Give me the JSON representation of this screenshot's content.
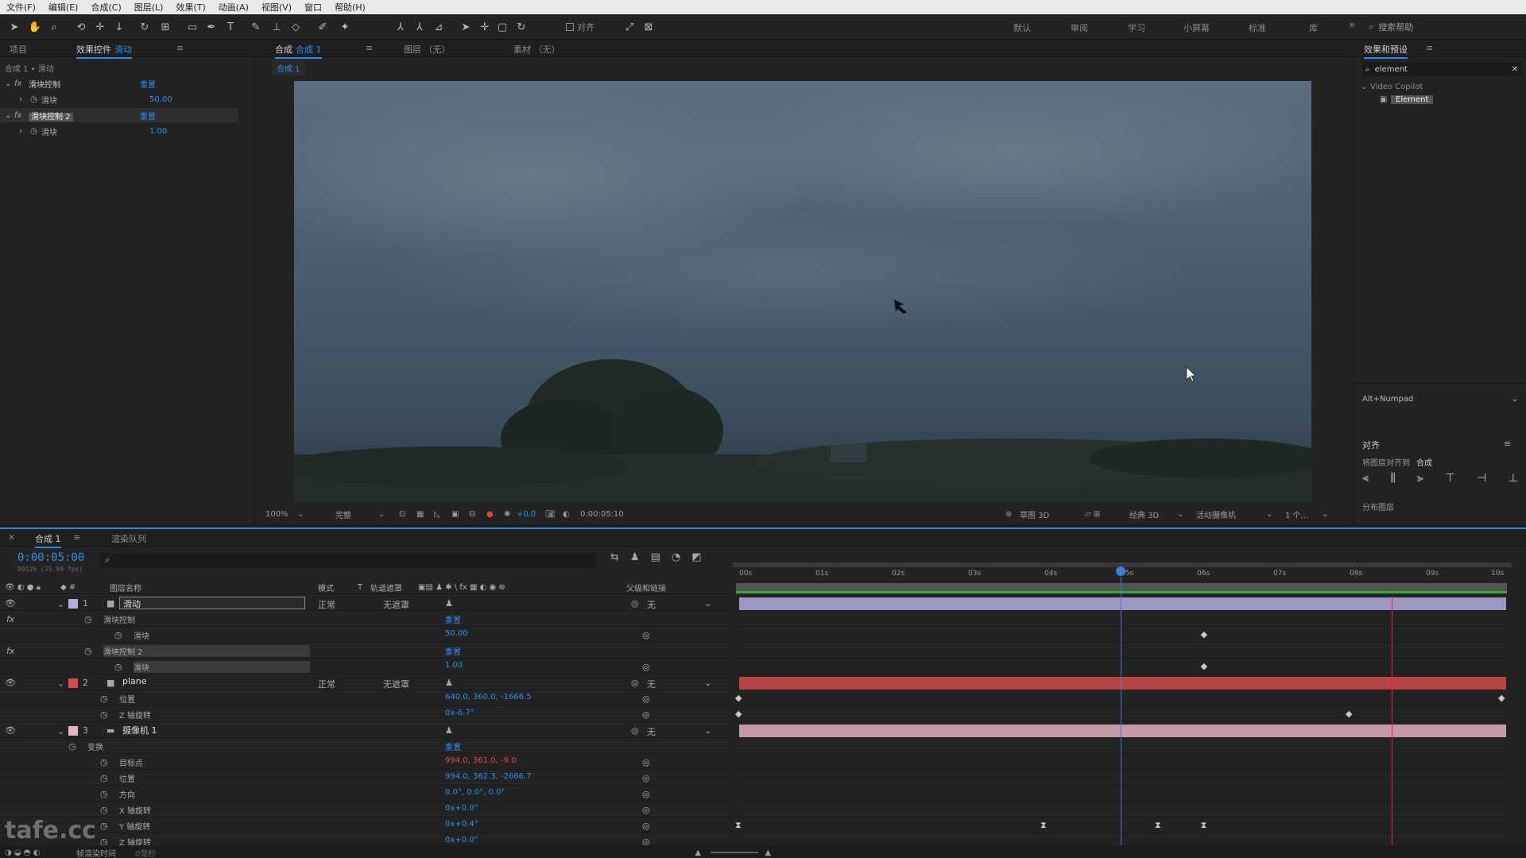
{
  "menu": [
    "文件(F)",
    "编辑(E)",
    "合成(C)",
    "图层(L)",
    "效果(T)",
    "动画(A)",
    "视图(V)",
    "窗口",
    "帮助(H)"
  ],
  "toolbar": {
    "snap_label": "对齐",
    "workspaces": [
      "默认",
      "审阅",
      "学习",
      "小屏幕",
      "标准",
      "库"
    ],
    "search_placeholder": "搜索帮助"
  },
  "left_panel": {
    "tab_project": "项目",
    "tab_effects_prefix": "效果控件",
    "tab_effects_layer": "滑动",
    "breadcrumb": "合成 1 • 滑动",
    "effects": [
      {
        "fx": "fx",
        "name": "滑块控制",
        "reset": "重置",
        "prop": "滑块",
        "value": "50.00"
      },
      {
        "fx": "fx",
        "name": "滑块控制 2",
        "reset": "重置",
        "prop": "滑块",
        "value": "1.00"
      }
    ]
  },
  "comp_panel": {
    "tab_comp": "合成",
    "tab_comp_name": "合成 1",
    "tab_layer": "图层 （无）",
    "tab_footage": "素材 （无）",
    "comp_label": "合成 1",
    "zoom": "100%",
    "quality": "完整",
    "exposure": "+0.0",
    "timecode": "0:00:05:10",
    "renderer_draft": "草图 3D",
    "renderer": "经典 3D",
    "camera": "活动摄像机",
    "views": "1 个..."
  },
  "right_panel": {
    "tab_effects_presets": "效果和预设",
    "search_value": "element",
    "category": "Video Copilot",
    "item": "Element",
    "shortcut": "Alt+Numpad",
    "align_title": "对齐",
    "align_to_label": "将图层对齐到",
    "align_to_value": "合成",
    "distribute_label": "分布图层"
  },
  "timeline": {
    "tab_comp": "合成 1",
    "tab_render": "渲染队列",
    "timecode": "0:00:05:00",
    "timecode_sub": "00125 (25.00 fps)",
    "headers": {
      "layer_name": "图层名称",
      "mode": "模式",
      "t": "T",
      "trkmat": "轨道遮罩",
      "parent": "父级和链接"
    },
    "ruler_ticks": [
      "00s",
      "01s",
      "02s",
      "03s",
      "04s",
      "05s",
      "06s",
      "07s",
      "08s",
      "09s",
      "10s"
    ],
    "playhead_seconds": 5.0,
    "work_end_seconds": 8.55,
    "duration_seconds": 10,
    "layers": [
      {
        "num": "1",
        "name": "滑动",
        "color": "#b7a8de",
        "mode": "正常",
        "trkmat": "无遮罩",
        "parent": "无"
      },
      {
        "num": "2",
        "name": "plane",
        "color": "#d94a4a",
        "mode": "正常",
        "trkmat": "无遮罩",
        "parent": "无"
      },
      {
        "num": "3",
        "name": "摄像机 1",
        "color": "#e8b4c4",
        "mode": "",
        "trkmat": "",
        "parent": "无"
      }
    ],
    "sub_rows": [
      {
        "label": "滑块控制",
        "value": "重置"
      },
      {
        "label": "滑块",
        "value": "50.00"
      },
      {
        "label": "滑块控制 2",
        "value": "重置"
      },
      {
        "label": "滑块",
        "value": "1.00"
      },
      {
        "label": "位置",
        "value": "640.0, 360.0, -1666.5"
      },
      {
        "label": "Z 轴旋转",
        "value": "0x-6.7°"
      },
      {
        "label": "变换",
        "value": "重置"
      },
      {
        "label": "目标点",
        "value": "994.0, 361.0, -9.0"
      },
      {
        "label": "位置",
        "value": "994.0, 362.3, -2666.7"
      },
      {
        "label": "方向",
        "value": "0.0°, 0.0°, 0.0°"
      },
      {
        "label": "X 轴旋转",
        "value": "0x+0.0°"
      },
      {
        "label": "Y 轴旋转",
        "value": "0x+0.4°"
      },
      {
        "label": "Z 轴旋转",
        "value": "0x+0.0°"
      }
    ],
    "footer_label": "帧渲染时间",
    "footer_value": "0毫秒"
  },
  "watermark": "tafe.cc",
  "colors": {
    "accent": "#2d8ceb",
    "playhead": "#3d7dd6",
    "work_end": "#d03030"
  }
}
